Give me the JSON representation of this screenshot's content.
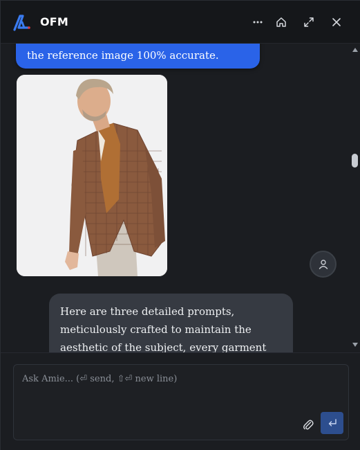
{
  "header": {
    "app_title": "OFM",
    "icons": [
      "logo-icon",
      "more-icon",
      "home-icon",
      "expand-icon",
      "close-icon"
    ]
  },
  "chat": {
    "user_message_visible": "the reference image 100% accurate.",
    "image": {
      "description_icon": "photo",
      "subject": "man in houndstooth blazer"
    },
    "assistant_message_visible": "Here are three detailed prompts, meticulously crafted to maintain the aesthetic of the subject, every garment detail, and the fidelity of the"
  },
  "composer": {
    "placeholder": "Ask Amie... (⏎ send, ⇧⏎ new line)",
    "value": ""
  },
  "colors": {
    "user_bubble": "#2a63e8",
    "assistant_bubble": "#363a42",
    "background": "#1b1d21",
    "send_button": "#2d4e8e"
  }
}
